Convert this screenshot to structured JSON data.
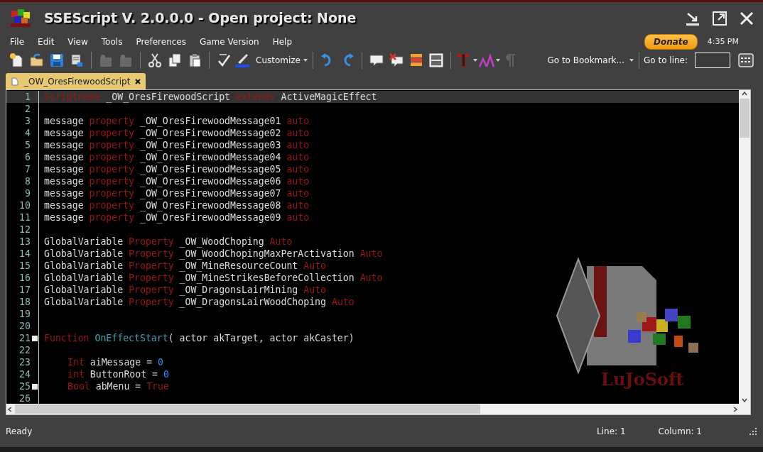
{
  "window": {
    "title": "SSEScript V. 2.0.0.0 - Open project: None"
  },
  "menu": [
    "File",
    "Edit",
    "View",
    "Tools",
    "Preferences",
    "Game Version",
    "Help"
  ],
  "donate": {
    "label": "Donate"
  },
  "clock": "4:35 PM",
  "toolbar": {
    "groups": [
      [
        {
          "disabled": false
        },
        {
          "disabled": false
        },
        {
          "disabled": false
        },
        {
          "disabled": false
        }
      ],
      [
        {
          "disabled": true
        },
        {
          "disabled": true
        }
      ],
      [
        {
          "disabled": false
        },
        {
          "disabled": false
        },
        {
          "disabled": false
        }
      ],
      [
        {
          "disabled": false
        },
        {
          "disabled": false,
          "label": "Customize",
          "dropdown": true
        }
      ],
      [
        {
          "disabled": false
        },
        {
          "disabled": false
        }
      ],
      [
        {
          "disabled": false
        },
        {
          "disabled": false
        },
        {
          "disabled": false
        },
        {
          "disabled": false
        }
      ],
      [
        {
          "disabled": false,
          "dropdown": true
        },
        {
          "disabled": false,
          "dropdown": true
        },
        {
          "disabled": true
        }
      ]
    ],
    "bookmark": "Go to Bookmark...",
    "goto_label": "Go to line:"
  },
  "tabs": [
    {
      "label": "_OW_OresFirewoodScript",
      "selected": true
    }
  ],
  "editor": {
    "logo_text": "LuJoSoft",
    "lines": [
      {
        "number": "1",
        "current": true,
        "tokens": [
          {
            "kind": "keyword",
            "text": "Scriptname"
          },
          {
            "kind": "plain",
            "text": " _OW_OresFirewoodScript "
          },
          {
            "kind": "keyword",
            "text": "extends"
          },
          {
            "kind": "plain",
            "text": " ActiveMagicEffect"
          }
        ]
      },
      {
        "number": "2",
        "current": false
      },
      {
        "number": "3",
        "current": false,
        "tokens": [
          {
            "kind": "plain",
            "text": "message "
          },
          {
            "kind": "keyword",
            "text": "property"
          },
          {
            "kind": "plain",
            "text": " _OW_OresFirewoodMessage01 "
          },
          {
            "kind": "keyword",
            "text": "auto"
          }
        ]
      },
      {
        "number": "4",
        "current": false,
        "tokens": [
          {
            "kind": "plain",
            "text": "message "
          },
          {
            "kind": "keyword",
            "text": "property"
          },
          {
            "kind": "plain",
            "text": " _OW_OresFirewoodMessage02 "
          },
          {
            "kind": "keyword",
            "text": "auto"
          }
        ]
      },
      {
        "number": "5",
        "current": false,
        "tokens": [
          {
            "kind": "plain",
            "text": "message "
          },
          {
            "kind": "keyword",
            "text": "property"
          },
          {
            "kind": "plain",
            "text": " _OW_OresFirewoodMessage03 "
          },
          {
            "kind": "keyword",
            "text": "auto"
          }
        ]
      },
      {
        "number": "6",
        "current": false,
        "tokens": [
          {
            "kind": "plain",
            "text": "message "
          },
          {
            "kind": "keyword",
            "text": "property"
          },
          {
            "kind": "plain",
            "text": " _OW_OresFirewoodMessage04 "
          },
          {
            "kind": "keyword",
            "text": "auto"
          }
        ]
      },
      {
        "number": "7",
        "current": false,
        "tokens": [
          {
            "kind": "plain",
            "text": "message "
          },
          {
            "kind": "keyword",
            "text": "property"
          },
          {
            "kind": "plain",
            "text": " _OW_OresFirewoodMessage05 "
          },
          {
            "kind": "keyword",
            "text": "auto"
          }
        ]
      },
      {
        "number": "8",
        "current": false,
        "tokens": [
          {
            "kind": "plain",
            "text": "message "
          },
          {
            "kind": "keyword",
            "text": "property"
          },
          {
            "kind": "plain",
            "text": " _OW_OresFirewoodMessage06 "
          },
          {
            "kind": "keyword",
            "text": "auto"
          }
        ]
      },
      {
        "number": "9",
        "current": false,
        "tokens": [
          {
            "kind": "plain",
            "text": "message "
          },
          {
            "kind": "keyword",
            "text": "property"
          },
          {
            "kind": "plain",
            "text": " _OW_OresFirewoodMessage07 "
          },
          {
            "kind": "keyword",
            "text": "auto"
          }
        ]
      },
      {
        "number": "10",
        "current": false,
        "tokens": [
          {
            "kind": "plain",
            "text": "message "
          },
          {
            "kind": "keyword",
            "text": "property"
          },
          {
            "kind": "plain",
            "text": " _OW_OresFirewoodMessage08 "
          },
          {
            "kind": "keyword",
            "text": "auto"
          }
        ]
      },
      {
        "number": "11",
        "current": false,
        "tokens": [
          {
            "kind": "plain",
            "text": "message "
          },
          {
            "kind": "keyword",
            "text": "property"
          },
          {
            "kind": "plain",
            "text": " _OW_OresFirewoodMessage09 "
          },
          {
            "kind": "keyword",
            "text": "auto"
          }
        ]
      },
      {
        "number": "12",
        "current": false
      },
      {
        "number": "13",
        "current": false,
        "tokens": [
          {
            "kind": "plain",
            "text": "GlobalVariable "
          },
          {
            "kind": "keyword",
            "text": "Property"
          },
          {
            "kind": "plain",
            "text": " _OW_WoodChoping "
          },
          {
            "kind": "keyword",
            "text": "Auto"
          }
        ]
      },
      {
        "number": "14",
        "current": false,
        "tokens": [
          {
            "kind": "plain",
            "text": "GlobalVariable "
          },
          {
            "kind": "keyword",
            "text": "Property"
          },
          {
            "kind": "plain",
            "text": " _OW_WoodChopingMaxPerActivation "
          },
          {
            "kind": "keyword",
            "text": "Auto"
          }
        ]
      },
      {
        "number": "15",
        "current": false,
        "tokens": [
          {
            "kind": "plain",
            "text": "GlobalVariable "
          },
          {
            "kind": "keyword",
            "text": "Property"
          },
          {
            "kind": "plain",
            "text": " _OW_MineResourceCount "
          },
          {
            "kind": "keyword",
            "text": "Auto"
          }
        ]
      },
      {
        "number": "16",
        "current": false,
        "tokens": [
          {
            "kind": "plain",
            "text": "GlobalVariable "
          },
          {
            "kind": "keyword",
            "text": "Property"
          },
          {
            "kind": "plain",
            "text": " _OW_MineStrikesBeforeCollection "
          },
          {
            "kind": "keyword",
            "text": "Auto"
          }
        ]
      },
      {
        "number": "17",
        "current": false,
        "tokens": [
          {
            "kind": "plain",
            "text": "GlobalVariable "
          },
          {
            "kind": "keyword",
            "text": "Property"
          },
          {
            "kind": "plain",
            "text": " _OW_DragonsLairMining "
          },
          {
            "kind": "keyword",
            "text": "Auto"
          }
        ]
      },
      {
        "number": "18",
        "current": false,
        "tokens": [
          {
            "kind": "plain",
            "text": "GlobalVariable "
          },
          {
            "kind": "keyword",
            "text": "Property"
          },
          {
            "kind": "plain",
            "text": " _OW_DragonsLairWoodChoping "
          },
          {
            "kind": "keyword",
            "text": "Auto"
          }
        ]
      },
      {
        "number": "19",
        "current": false
      },
      {
        "number": "20",
        "current": false
      },
      {
        "number": "21",
        "current": false,
        "fold": true,
        "tokens": [
          {
            "kind": "keyword",
            "text": "Function"
          },
          {
            "kind": "function",
            "text": " OnEffectStart"
          },
          {
            "kind": "plain",
            "text": "( actor akTarget, actor akCaster)"
          }
        ]
      },
      {
        "number": "22",
        "current": false
      },
      {
        "number": "23",
        "current": false,
        "indented": true,
        "tokens": [
          {
            "kind": "keyword",
            "text": "Int"
          },
          {
            "kind": "plain",
            "text": " aiMessage = "
          },
          {
            "kind": "number",
            "text": "0"
          }
        ]
      },
      {
        "number": "24",
        "current": false,
        "indented": true,
        "tokens": [
          {
            "kind": "keyword",
            "text": "int"
          },
          {
            "kind": "plain",
            "text": " ButtonRoot = "
          },
          {
            "kind": "number",
            "text": "0"
          }
        ]
      },
      {
        "number": "25",
        "current": false,
        "indented": true,
        "fold": true,
        "tokens": [
          {
            "kind": "keyword",
            "text": "Bool"
          },
          {
            "kind": "plain",
            "text": " abMenu = "
          },
          {
            "kind": "keyword",
            "text": "True"
          }
        ]
      },
      {
        "number": "26",
        "current": false
      }
    ]
  },
  "status_bar": {
    "message": "Ready",
    "line": "Line: 1",
    "column": "Column: 1"
  }
}
